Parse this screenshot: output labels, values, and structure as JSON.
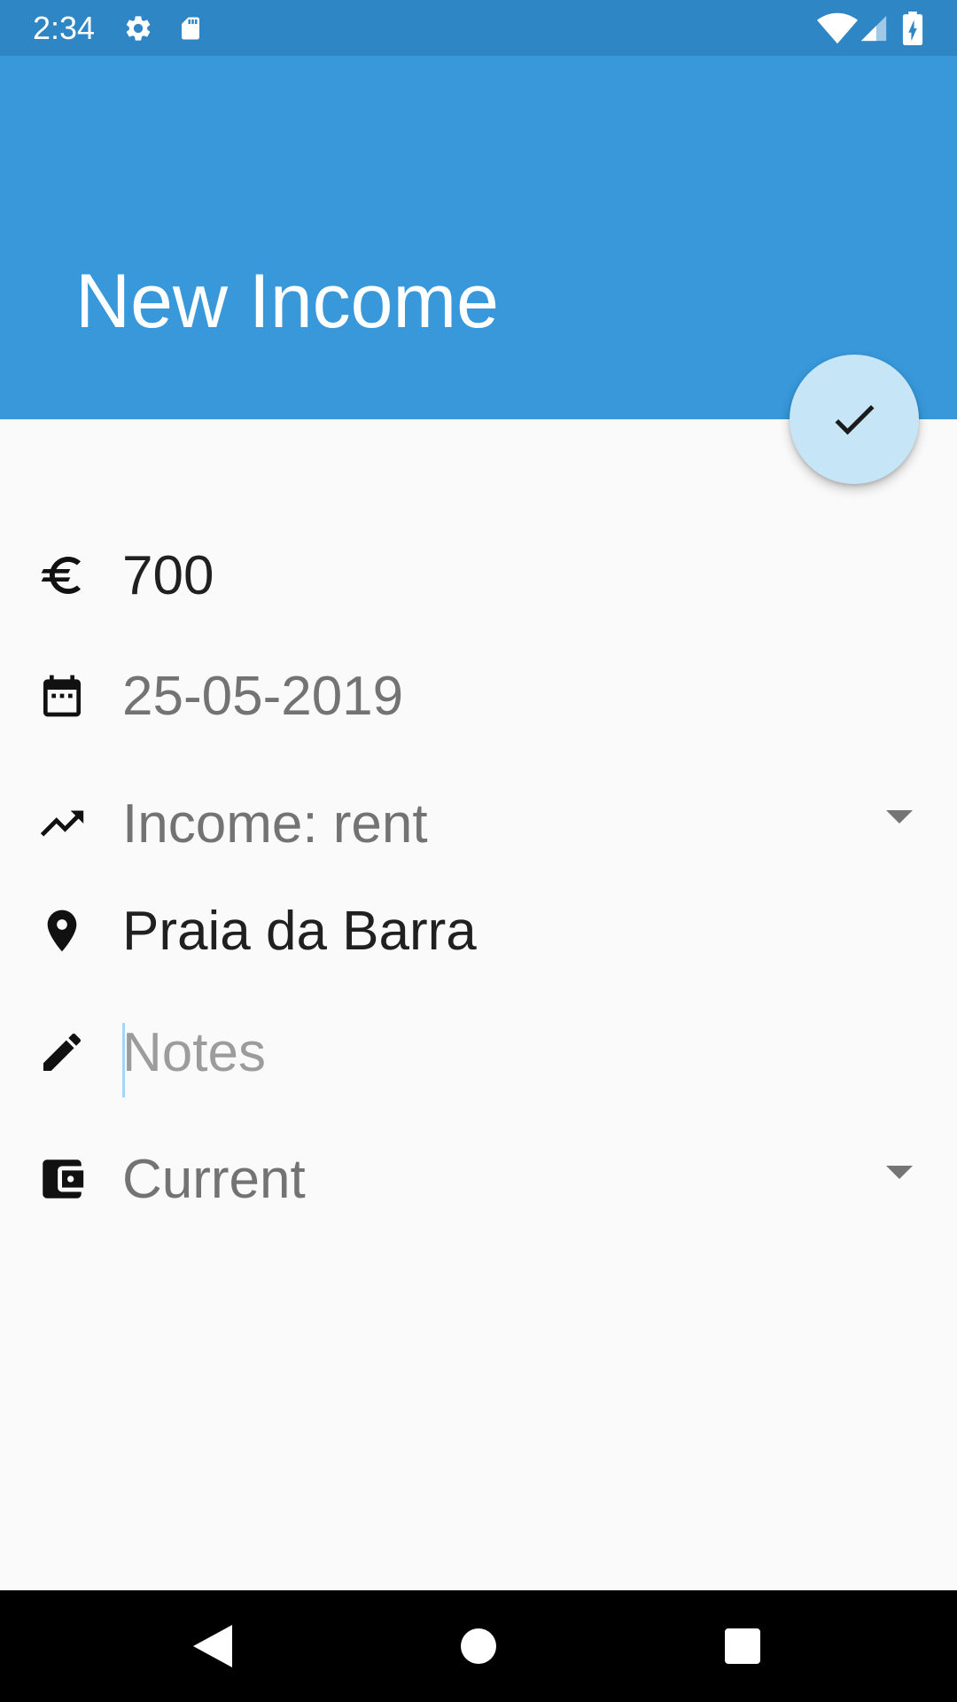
{
  "status_bar": {
    "time": "2:34",
    "icons": [
      "gear-icon",
      "sd-card-icon",
      "wifi-icon",
      "signal-icon",
      "battery-charging-icon"
    ]
  },
  "header": {
    "title": "New Income",
    "background_color": "#3898da",
    "status_color": "#2f86c4"
  },
  "fab": {
    "icon": "check-icon",
    "background_color": "#c6e6f8"
  },
  "form": {
    "amount": {
      "icon": "euro-icon",
      "value": "700"
    },
    "date": {
      "icon": "calendar-icon",
      "value": "25-05-2019"
    },
    "category": {
      "icon": "trending-up-icon",
      "selected": "Income: rent"
    },
    "location": {
      "icon": "location-pin-icon",
      "value": "Praia da Barra"
    },
    "notes": {
      "icon": "pencil-icon",
      "value": "",
      "placeholder": "Notes"
    },
    "account": {
      "icon": "wallet-icon",
      "selected": "Current"
    }
  },
  "nav_bar": {
    "buttons": [
      "back-icon",
      "home-icon",
      "recents-icon"
    ]
  }
}
